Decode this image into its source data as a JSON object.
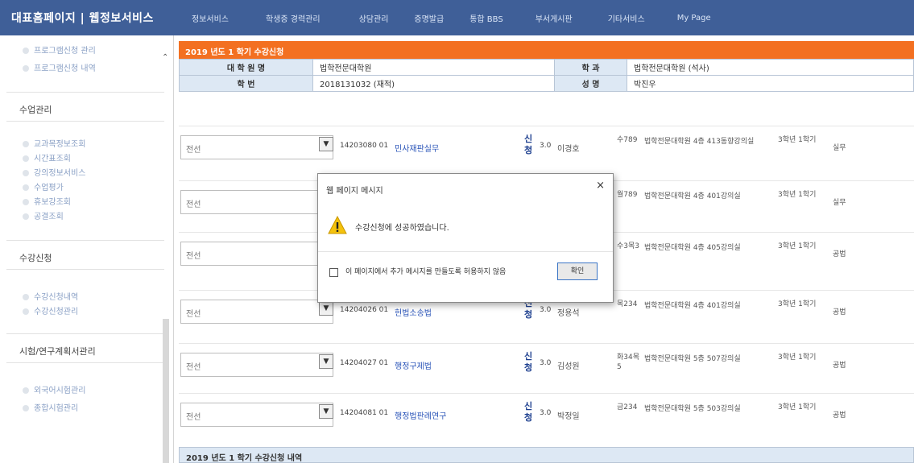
{
  "header": {
    "brand": "대표홈페이지 | 웹정보서비스",
    "nav": [
      "정보서비스",
      "학생증 경력관리",
      "상담관리",
      "증명발급",
      "통합 BBS",
      "부서게시판",
      "기타서비스",
      "My Page"
    ]
  },
  "sidebar": {
    "top_items": [
      "프로그램신청 관리",
      "프로그램신청 내역"
    ],
    "sections": [
      {
        "title": "수업관리",
        "items": [
          "교과목정보조회",
          "시간표조회",
          "강의정보서비스",
          "수업평가",
          "휴보강조회",
          "공결조회"
        ]
      },
      {
        "title": "수강신청",
        "items": [
          "수강신청내역",
          "수강신청관리"
        ]
      },
      {
        "title": "시험/연구계획서관리",
        "items": [
          "외국어시험관리",
          "종합시험관리"
        ]
      }
    ]
  },
  "main": {
    "title": "2019 년도 1 학기 수강신청",
    "info": {
      "college_label": "대 학 원 명",
      "college_value": "법학전문대학원",
      "dept_label": "학 과",
      "dept_value": "법학전문대학원 (석사)",
      "id_label": "학 번",
      "id_value": "2018131032 (재적)",
      "name_label": "성 명",
      "name_value": "박진우"
    },
    "courses": [
      {
        "select": "전선",
        "code": "14203080  01",
        "name": "민사재판실무",
        "apply": "신청",
        "credit": "3.0",
        "prof": "이경호",
        "time": "수789",
        "room": "법학전문대학원 4층 413동향강의실",
        "term": "3학년 1학기",
        "type": "실무"
      },
      {
        "select": "전선",
        "code": "",
        "name": "",
        "apply": "",
        "credit": "",
        "prof": "",
        "time": "월789",
        "room": "법학전문대학원 4층 401강의실",
        "term": "3학년 1학기",
        "type": "실무"
      },
      {
        "select": "전선",
        "code": "",
        "name": "",
        "apply": "",
        "credit": "",
        "prof": "",
        "time": "수3목3",
        "room": "법학전문대학원 4층 405강의실",
        "term": "3학년 1학기",
        "type": "공법"
      },
      {
        "select": "전선",
        "code": "14204026  01",
        "name": "헌법소송법",
        "apply": "신청",
        "credit": "3.0",
        "prof": "정용석",
        "time": "목234",
        "room": "법학전문대학원 4층 401강의실",
        "term": "3학년 1학기",
        "type": "공법"
      },
      {
        "select": "전선",
        "code": "14204027  01",
        "name": "행정구제법",
        "apply": "신청",
        "credit": "3.0",
        "prof": "김성원",
        "time": "화34목5",
        "room": "법학전문대학원 5층 507강의실",
        "term": "3학년 1학기",
        "type": "공법"
      },
      {
        "select": "전선",
        "code": "14204081  01",
        "name": "행정법판례연구",
        "apply": "신청",
        "credit": "3.0",
        "prof": "박정일",
        "time": "금234",
        "room": "법학전문대학원 5층 503강의실",
        "term": "3학년 1학기",
        "type": "공법"
      }
    ],
    "history_title": "2019 년도 1 학기 수강신청 내역"
  },
  "dialog": {
    "title": "웹 페이지 메시지",
    "message": "수강신청에 성공하였습니다.",
    "checkbox_label": "이 페이지에서 추가 메시지를 만들도록 허용하지 않음",
    "ok_label": "확인",
    "close_symbol": "×"
  },
  "icons": {
    "select_arrow": "chevron-down-icon",
    "warning": "warning-icon",
    "scroll_up": "chevron-up-icon"
  },
  "colors": {
    "nav_bg": "#3f5f98",
    "title_bar": "#f37021",
    "info_label_bg": "#dde8f4",
    "link": "#2a54b8"
  }
}
